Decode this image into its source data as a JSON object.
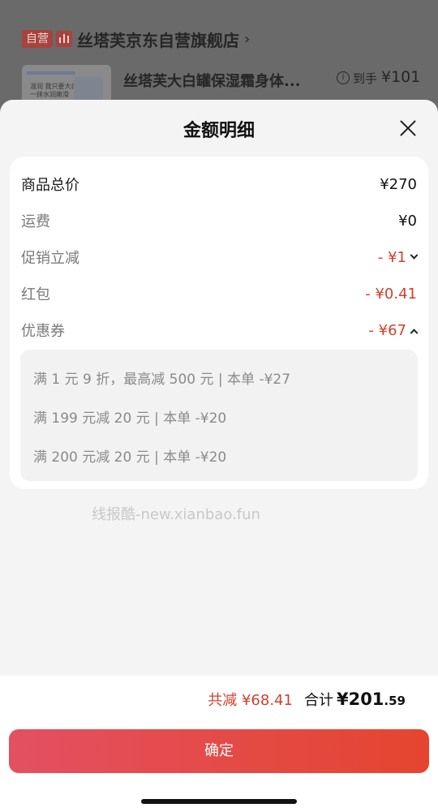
{
  "store": {
    "badge": "自营",
    "name": "丝塔芙京东自营旗舰店",
    "chevron": "›",
    "product_title": "丝塔芙大白罐保湿霜身体...",
    "arrive_label": "到手",
    "arrive_price": "¥101",
    "thumb_text": "温润 我只要大白罐\n一抹水润嫩滑"
  },
  "sheet": {
    "title": "金额明细",
    "rows": [
      {
        "label": "商品总价",
        "value": "¥270"
      },
      {
        "label": "运费",
        "value": "¥0"
      },
      {
        "label": "促销立减",
        "value": "- ¥1"
      },
      {
        "label": "红包",
        "value": "- ¥0.41"
      },
      {
        "label": "优惠券",
        "value": "- ¥67"
      }
    ],
    "coupons": [
      "满 1 元 9 折，最高减 500 元 | 本单 -¥27",
      "满 199 元减 20 元 | 本单 -¥20",
      "满 200 元减 20 元 | 本单 -¥20"
    ],
    "watermark": "线报酷-new.xianbao.fun"
  },
  "footer": {
    "total_cut": "共减 ¥68.41",
    "total_label": "合计",
    "total_big": "¥201",
    "total_small": ".59",
    "confirm_label": "确定"
  },
  "colors": {
    "accent_red": "#d0402e",
    "button_start": "#e35061",
    "button_end": "#e5452f"
  },
  "icons": [
    "store-chart-icon",
    "info-icon",
    "close-icon",
    "chevron-down-icon",
    "chevron-up-icon"
  ]
}
